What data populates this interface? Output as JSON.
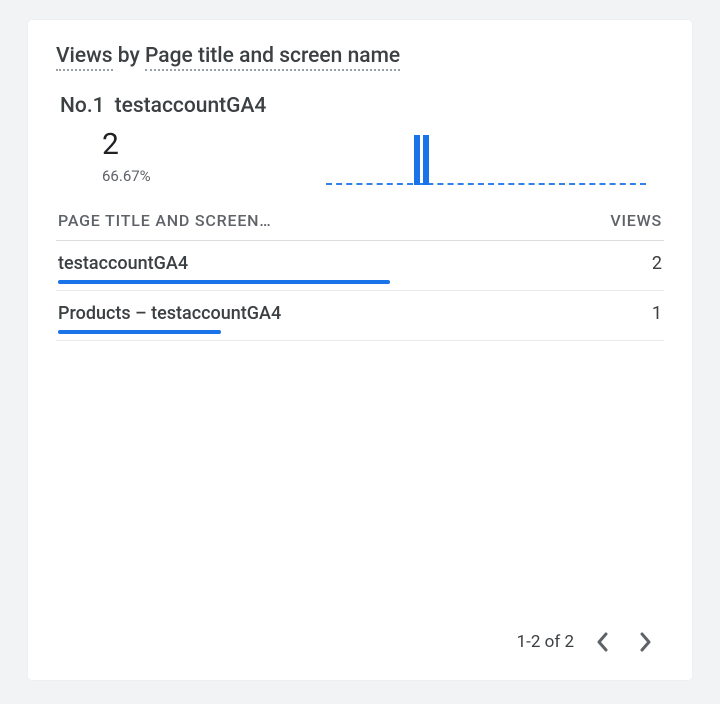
{
  "title": {
    "seg1": "Views",
    "by": " by ",
    "seg2": "Page title and screen name"
  },
  "summary": {
    "rank_prefix": "No.1",
    "rank_label": "testaccountGA4",
    "value": "2",
    "percent": "66.67%"
  },
  "table": {
    "header_left": "PAGE TITLE AND SCREEN…",
    "header_right": "VIEWS",
    "rows": [
      {
        "label": "testaccountGA4",
        "value": "2",
        "bar_pct": 55
      },
      {
        "label": "Products – testaccountGA4",
        "value": "1",
        "bar_pct": 27
      }
    ]
  },
  "pager": {
    "range": "1-2 of 2"
  },
  "chart_data": {
    "type": "bar",
    "title": "Views by Page title and screen name",
    "xlabel": "Page title and screen name",
    "ylabel": "Views",
    "categories": [
      "testaccountGA4",
      "Products – testaccountGA4"
    ],
    "values": [
      2,
      1
    ],
    "ylim": [
      0,
      2
    ]
  }
}
